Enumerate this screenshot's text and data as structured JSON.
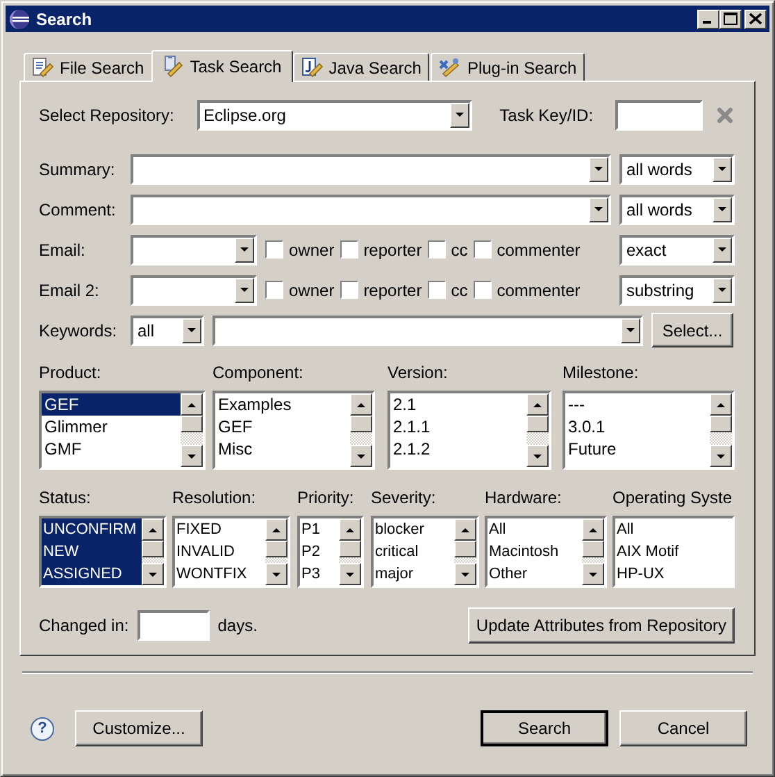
{
  "window": {
    "title": "Search"
  },
  "tabs": [
    {
      "label": "File Search",
      "selected": false
    },
    {
      "label": "Task Search",
      "selected": true
    },
    {
      "label": "Java Search",
      "selected": false
    },
    {
      "label": "Plug-in Search",
      "selected": false
    }
  ],
  "repository": {
    "label": "Select Repository:",
    "value": "Eclipse.org",
    "key_label": "Task Key/ID:"
  },
  "text_fields": [
    {
      "label": "Summary:",
      "match": "all words"
    },
    {
      "label": "Comment:",
      "match": "all words"
    }
  ],
  "email_rows": [
    {
      "label": "Email:",
      "roles": [
        {
          "label": "owner",
          "checked": false
        },
        {
          "label": "reporter",
          "checked": false
        },
        {
          "label": "cc",
          "checked": false
        },
        {
          "label": "commenter",
          "checked": false
        }
      ],
      "match": "exact"
    },
    {
      "label": "Email 2:",
      "roles": [
        {
          "label": "owner",
          "checked": false
        },
        {
          "label": "reporter",
          "checked": false
        },
        {
          "label": "cc",
          "checked": false
        },
        {
          "label": "commenter",
          "checked": false
        }
      ],
      "match": "substring"
    }
  ],
  "keywords": {
    "label": "Keywords:",
    "mode": "all",
    "button": "Select..."
  },
  "lists_top": [
    {
      "label": "Product:",
      "items": [
        {
          "text": "GEF",
          "selected": true
        },
        {
          "text": "Glimmer",
          "selected": false
        },
        {
          "text": "GMF",
          "selected": false
        }
      ]
    },
    {
      "label": "Component:",
      "items": [
        {
          "text": "Examples",
          "selected": false
        },
        {
          "text": "GEF",
          "selected": false
        },
        {
          "text": "Misc",
          "selected": false
        }
      ]
    },
    {
      "label": "Version:",
      "items": [
        {
          "text": "2.1",
          "selected": false
        },
        {
          "text": "2.1.1",
          "selected": false
        },
        {
          "text": "2.1.2",
          "selected": false
        }
      ]
    },
    {
      "label": "Milestone:",
      "items": [
        {
          "text": "---",
          "selected": false
        },
        {
          "text": "3.0.1",
          "selected": false
        },
        {
          "text": "Future",
          "selected": false
        }
      ]
    }
  ],
  "lists_bottom": [
    {
      "label": "Status:",
      "items": [
        {
          "text": "UNCONFIRM",
          "selected": true
        },
        {
          "text": "NEW",
          "selected": true
        },
        {
          "text": "ASSIGNED",
          "selected": true
        }
      ]
    },
    {
      "label": "Resolution:",
      "items": [
        {
          "text": "FIXED",
          "selected": false
        },
        {
          "text": "INVALID",
          "selected": false
        },
        {
          "text": "WONTFIX",
          "selected": false
        }
      ]
    },
    {
      "label": "Priority:",
      "items": [
        {
          "text": "P1",
          "selected": false
        },
        {
          "text": "P2",
          "selected": false
        },
        {
          "text": "P3",
          "selected": false
        }
      ]
    },
    {
      "label": "Severity:",
      "items": [
        {
          "text": "blocker",
          "selected": false
        },
        {
          "text": "critical",
          "selected": false
        },
        {
          "text": "major",
          "selected": false
        }
      ]
    },
    {
      "label": "Hardware:",
      "items": [
        {
          "text": "All",
          "selected": false
        },
        {
          "text": "Macintosh",
          "selected": false
        },
        {
          "text": "Other",
          "selected": false
        }
      ]
    },
    {
      "label": "Operating Syste",
      "items": [
        {
          "text": "All",
          "selected": false
        },
        {
          "text": "AIX Motif",
          "selected": false
        },
        {
          "text": "HP-UX",
          "selected": false
        }
      ]
    }
  ],
  "changed_in": {
    "label": "Changed in:",
    "suffix": "days."
  },
  "update_button": "Update Attributes from Repository",
  "footer": {
    "help": "?",
    "buttons": [
      {
        "label": "Customize...",
        "default": false
      },
      {
        "label": "Search",
        "default": true
      },
      {
        "label": "Cancel",
        "default": false
      }
    ]
  }
}
